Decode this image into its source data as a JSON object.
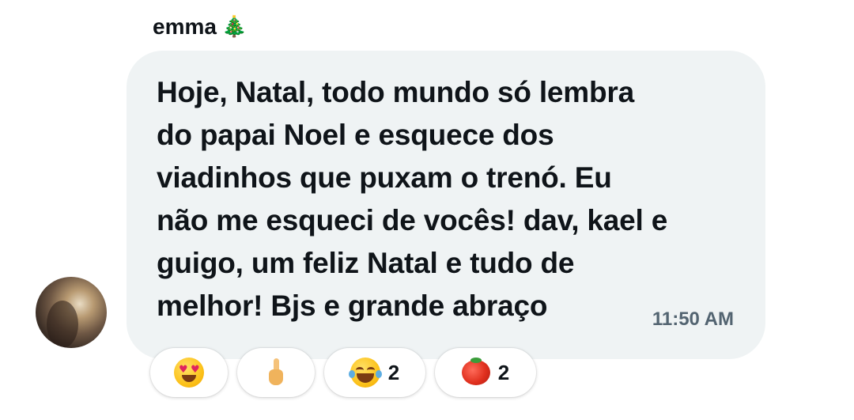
{
  "sender": {
    "name": "emma",
    "emoji": "🎄",
    "emoji_icon": "christmas-tree-icon"
  },
  "message": {
    "lines": [
      "Hoje, Natal, todo mundo só lembra",
      "do papai Noel e esquece dos",
      "viadinhos que puxam o trenó. Eu",
      "não me esqueci de vocês! dav, kael e",
      "guigo, um feliz Natal e tudo de",
      "melhor! Bjs e grande abraço"
    ],
    "time": "11:50 AM"
  },
  "reactions": [
    {
      "icon": "heart-eyes-face-icon",
      "count": ""
    },
    {
      "icon": "middle-finger-icon",
      "count": ""
    },
    {
      "icon": "tears-of-joy-face-icon",
      "count": "2"
    },
    {
      "icon": "tomato-icon",
      "count": "2"
    }
  ],
  "colors": {
    "bubble": "#eff3f4",
    "text": "#0f1419",
    "timestamp": "#536471"
  }
}
